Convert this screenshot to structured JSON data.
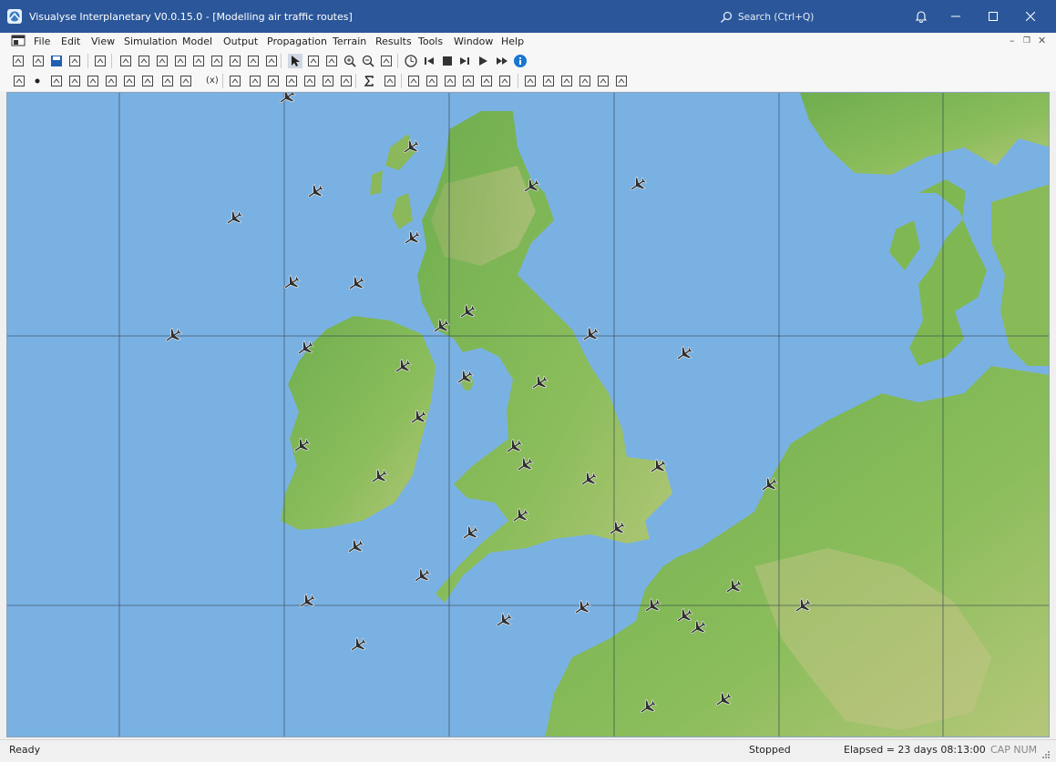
{
  "window": {
    "title": "Visualyse Interplanetary V0.0.15.0 - [Modelling air traffic routes]",
    "search_placeholder": "Search (Ctrl+Q)",
    "minimize_icon": "minimize-icon",
    "maximize_icon": "maximize-icon",
    "close_icon": "close-icon",
    "bell_icon": "bell-icon"
  },
  "menu": {
    "items": [
      "File",
      "Edit",
      "View",
      "Simulation",
      "Model",
      "Output",
      "Propagation",
      "Terrain",
      "Results",
      "Tools",
      "Window",
      "Help"
    ]
  },
  "toolbars": {
    "row1_icons": [
      "new-icon",
      "open-icon",
      "save-icon",
      "save-as-icon",
      "copy-icon",
      "antenna-station-icon",
      "mobile-station-icon",
      "link-icon",
      "beam-icon",
      "group-icon",
      "area-icon",
      "table-icon",
      "map-icon",
      "message-icon",
      "select-arrow-icon",
      "select-alt-icon",
      "select-box-icon",
      "zoom-in-icon",
      "zoom-out-icon",
      "comment-icon",
      "clock-icon",
      "step-back-icon",
      "stop-icon",
      "step-icon",
      "play-icon",
      "fast-forward-icon",
      "info-icon"
    ],
    "row2_icons": [
      "transmitter-icon",
      "point-icon",
      "grid-points-icon",
      "line-segment-icon",
      "distance-icon",
      "boundary-icon",
      "pointer-line-icon",
      "route-icon",
      "swap-icon",
      "handover-icon",
      "variable-icon",
      "move-icon",
      "rotate-icon",
      "person-1-icon",
      "person-2-icon",
      "person-3-icon",
      "person-4-icon",
      "sum-icon",
      "export-icon",
      "display-1-icon",
      "display-2-icon",
      "display-3-icon",
      "display-4-icon",
      "display-5-icon",
      "display-6-icon",
      "terrain-icon",
      "clutter-icon",
      "path-icon",
      "profile-icon",
      "results-icon",
      "chart-icon"
    ],
    "variable_label": "(x)"
  },
  "map": {
    "background_color": "#7ab1e3",
    "aircraft_icon": "airplane-icon",
    "aircraft_count": 47
  },
  "status": {
    "ready": "Ready",
    "state": "Stopped",
    "elapsed": "Elapsed = 23 days 08:13:00",
    "indicators": "CAP NUM"
  }
}
